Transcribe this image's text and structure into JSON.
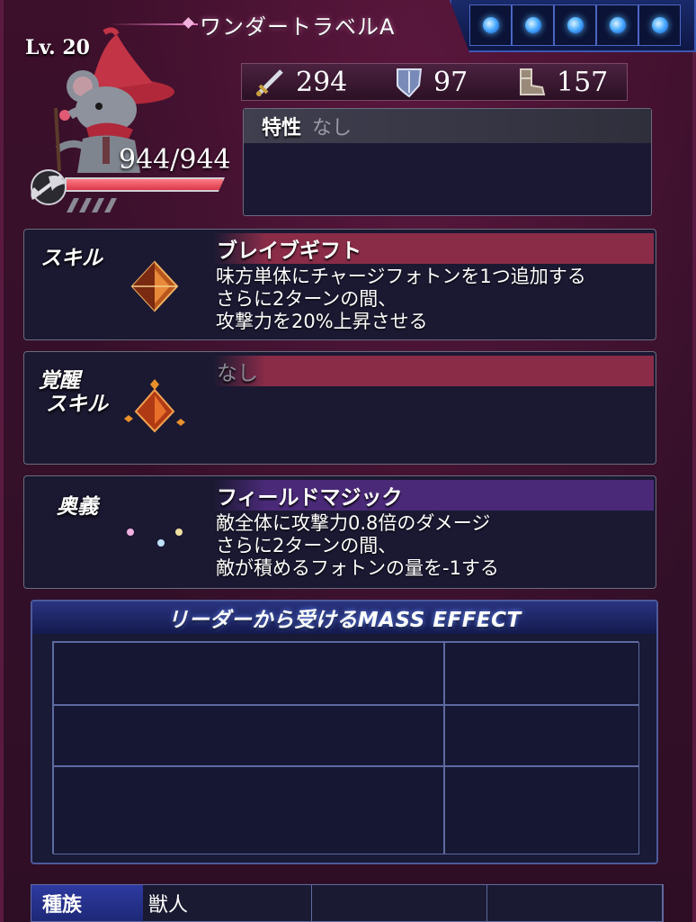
{
  "header": {
    "title": "ワンダートラベルA",
    "orbs": 5,
    "orb_color": "#46a8ff"
  },
  "character": {
    "level": "Lv. 20",
    "hp_text": "944/944",
    "hp_fraction": 1.0,
    "portrait": "gray-mouse-in-red-witch-hat",
    "weapon_icon": "axe-weapon-icon"
  },
  "stats": [
    {
      "icon": "sword-icon",
      "value": "294"
    },
    {
      "icon": "shield-icon",
      "value": "97"
    },
    {
      "icon": "boot-icon",
      "value": "157"
    }
  ],
  "trait": {
    "label": "特性",
    "value": "なし"
  },
  "skill": {
    "label": "スキル",
    "icon": "orange-crystal-icon",
    "name": "ブレイブギフト",
    "lines": [
      "味方単体にチャージフォトンを1つ追加する",
      "さらに2ターンの間、",
      "攻撃力を20%上昇させる"
    ]
  },
  "awaken": {
    "label_line1": "覚醒",
    "label_line2": "スキル",
    "icon": "awaken-crystal-icon",
    "name": "なし"
  },
  "ougi": {
    "label": "奥義",
    "icon": "rainbow-crescent-icon",
    "name": "フィールドマジック",
    "lines": [
      "敵全体に攻撃力0.8倍のダメージ",
      "さらに2ターンの間、",
      "敵が積めるフォトンの量を-1する"
    ]
  },
  "mass_effect": {
    "title": "リーダーから受けるMASS EFFECT"
  },
  "race": {
    "label": "種族",
    "value": "獣人"
  },
  "colors": {
    "background": "#3a1029",
    "panel": "#1b1932",
    "skill_header": "#8a2c48",
    "ougi_header": "#4a2a78",
    "mass_header": "#2a3480"
  }
}
